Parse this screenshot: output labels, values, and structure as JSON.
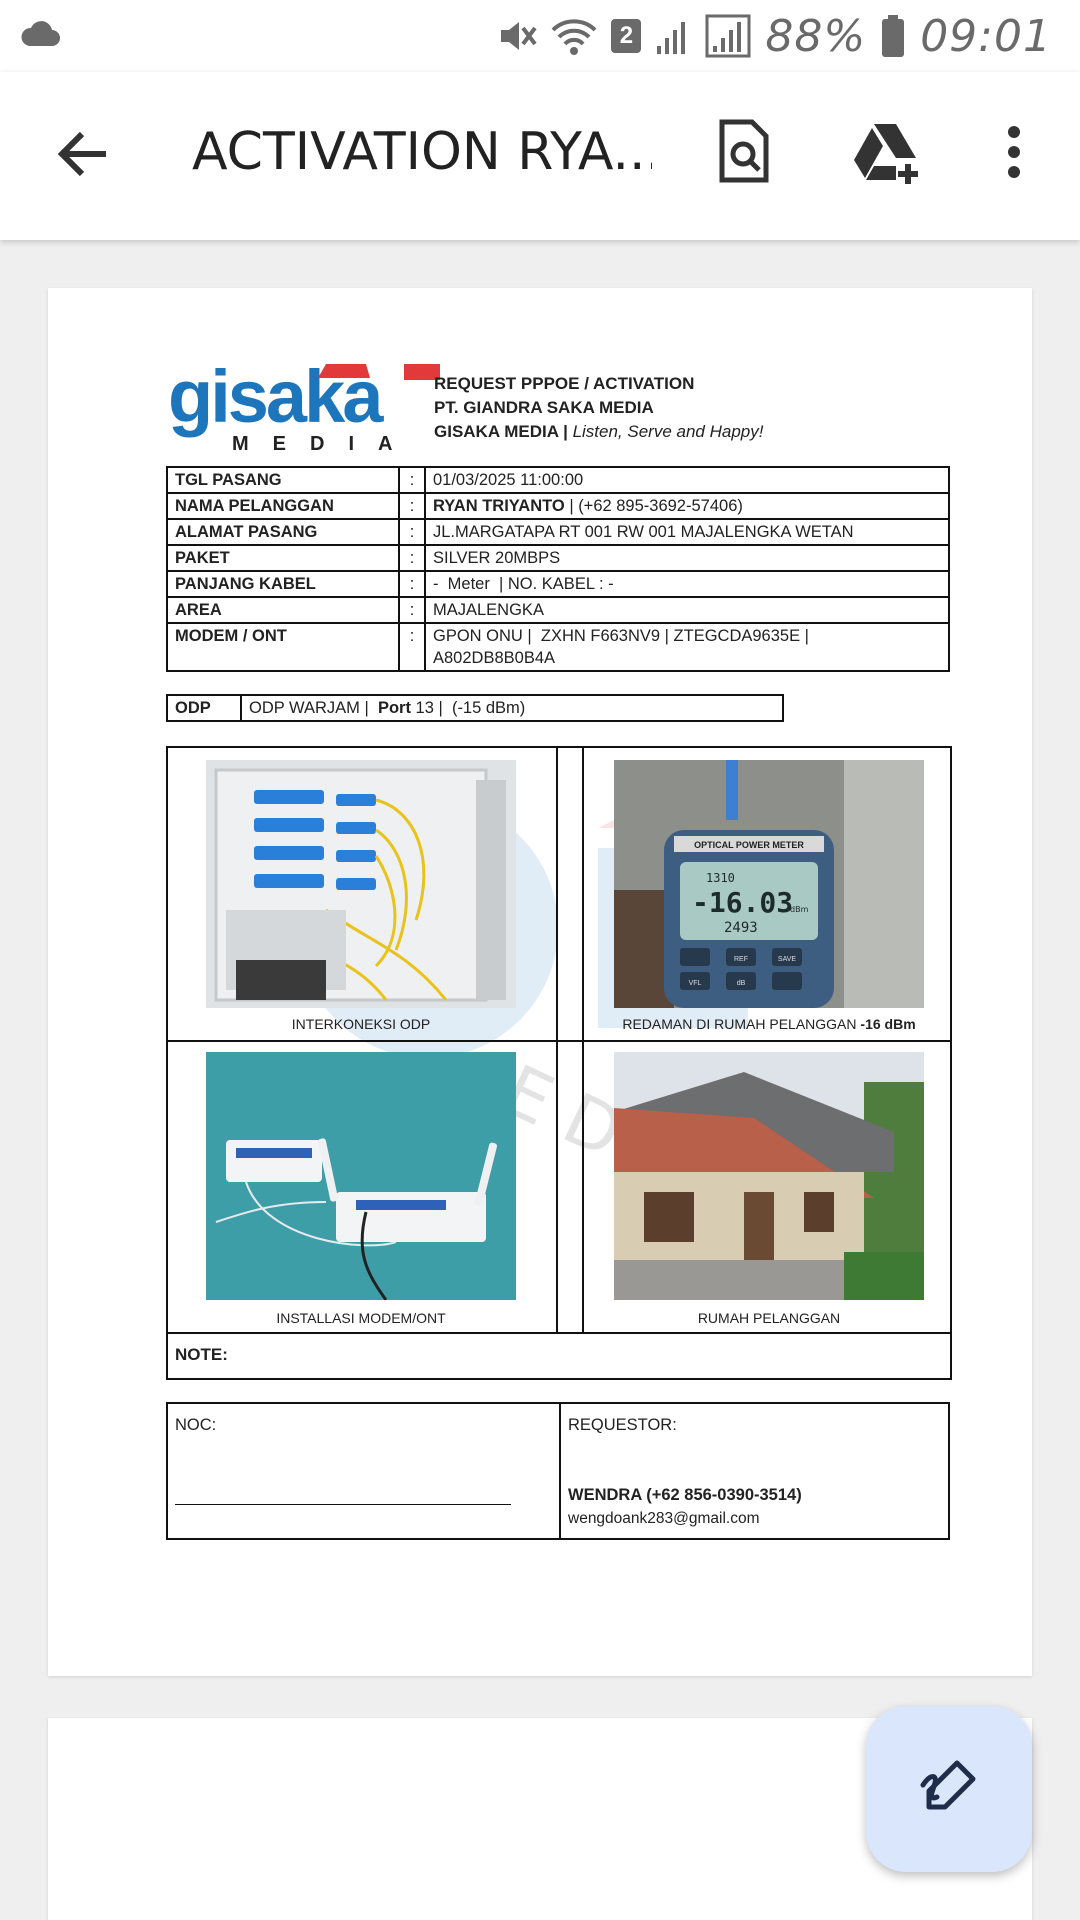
{
  "status_bar": {
    "battery_percent": "88%",
    "time": "09:01",
    "sim_badge": "2",
    "icons": [
      "cloud-icon",
      "mute-icon",
      "wifi-icon",
      "signal-icon",
      "signal-icon",
      "battery-icon"
    ]
  },
  "app_bar": {
    "title": "ACTIVATION RYA...",
    "icons": [
      "back-arrow-icon",
      "document-search-icon",
      "drive-add-icon",
      "more-vert-icon"
    ]
  },
  "document": {
    "logo": {
      "text": "gisaka",
      "sub": "M E D I A",
      "colors": {
        "blue": "#1d76bc",
        "red": "#e23a3a"
      }
    },
    "header": {
      "line1": "REQUEST PPPOE / ACTIVATION",
      "line2": "PT. GIANDRA SAKA MEDIA",
      "line3_bold": "GISAKA MEDIA",
      "line3_sep": " | ",
      "line3_italic": "Listen, Serve and Happy!"
    },
    "info_rows": [
      {
        "key": "TGL PASANG",
        "sep": ":",
        "value": "01/03/2025 11:00:00"
      },
      {
        "key": "NAMA PELANGGAN",
        "sep": ":",
        "value_bold": "RYAN TRIYANTO",
        "value": " | (+62 895-3692-57406)"
      },
      {
        "key": "ALAMAT PASANG",
        "sep": ":",
        "value": "JL.MARGATAPA RT 001 RW 001 MAJALENGKA WETAN"
      },
      {
        "key": "PAKET",
        "sep": ":",
        "value": "SILVER 20MBPS"
      },
      {
        "key": "PANJANG KABEL",
        "sep": ":",
        "value": "-  Meter  | NO. KABEL : -"
      },
      {
        "key": "AREA",
        "sep": ":",
        "value": "MAJALENGKA"
      },
      {
        "key": "MODEM / ONT",
        "sep": ":",
        "value": "GPON ONU |  ZXHN F663NV9 | ZTEGCDA9635E |",
        "value2": "A802DB8B0B4A"
      }
    ],
    "odp": {
      "key": "ODP",
      "value_pre": "ODP WARJAM |  ",
      "port_label": "Port",
      "value_post": " 13 |  (-15 dBm)"
    },
    "photos": [
      {
        "caption": "INTERKONEKSI ODP"
      },
      {
        "caption": "REDAMAN DI RUMAH PELANGGAN ",
        "caption_bold": "-16 dBm",
        "meter_top": "1310",
        "meter_mid": "-16.03",
        "meter_unit": "dBm",
        "meter_bottom": "2493",
        "meter_brand": "OPTICAL POWER METER",
        "meter_buttons": [
          "REF",
          "SAVE",
          "dB",
          "VFL"
        ]
      },
      {
        "caption": "INSTALLASI MODEM/ONT"
      },
      {
        "caption": "RUMAH PELANGGAN"
      }
    ],
    "note_label": "NOTE:",
    "noc_label": "NOC:",
    "requestor_label": "REQUESTOR:",
    "requestor_name": "WENDRA (+62 856-0390-3514)",
    "requestor_email": "wengdoank283@gmail.com"
  },
  "fab": {
    "icon": "edit-pen-icon"
  }
}
